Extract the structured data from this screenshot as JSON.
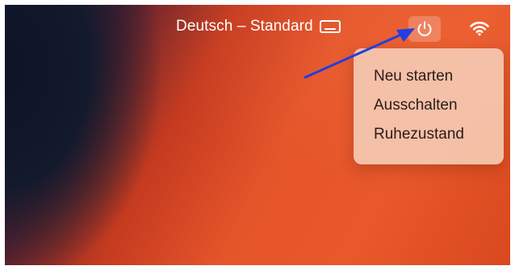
{
  "menubar": {
    "input_source_label": "Deutsch – Standard",
    "keyboard_icon": "keyboard-icon",
    "power_icon": "power-icon",
    "wifi_icon": "wifi-icon"
  },
  "power_menu": {
    "items": [
      {
        "label": "Neu starten"
      },
      {
        "label": "Ausschalten"
      },
      {
        "label": "Ruhezustand"
      }
    ]
  },
  "colors": {
    "annotation_arrow": "#1f3fe0",
    "menu_background": "#f4c8b0",
    "wallpaper_orange": "#e5552a",
    "wallpaper_dark": "#0e1326"
  }
}
